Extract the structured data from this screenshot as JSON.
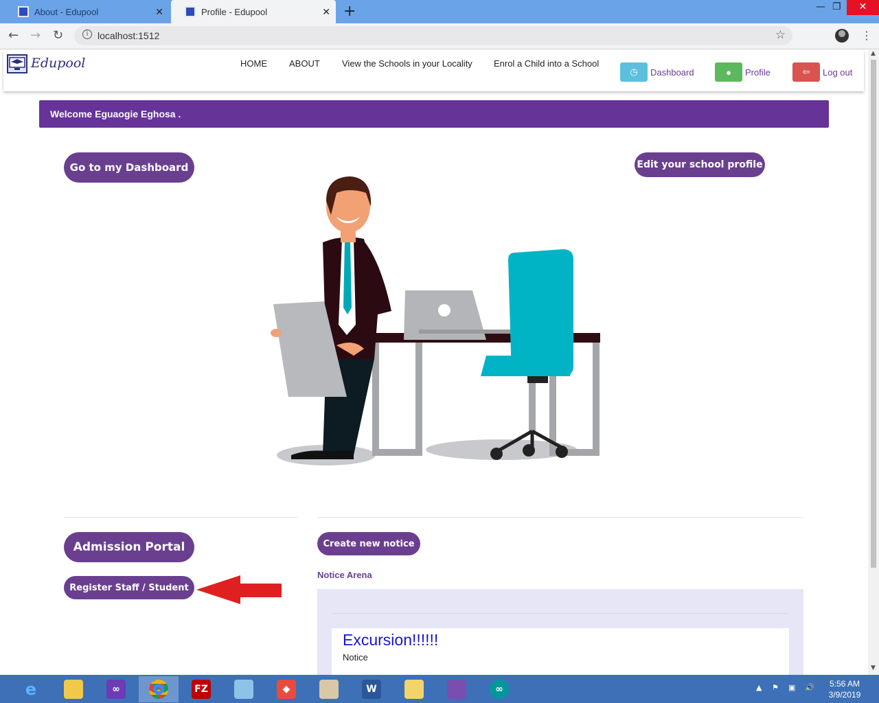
{
  "browser": {
    "tabs": [
      {
        "title": "About - Edupool"
      },
      {
        "title": "Profile - Edupool"
      }
    ],
    "url": "localhost:1512"
  },
  "navbar": {
    "brand": "Edupool",
    "links": [
      "HOME",
      "ABOUT",
      "View the Schools in your Locality",
      "Enrol a Child into a School"
    ],
    "buttons": [
      {
        "label": "Dashboard",
        "color": "#5bc0de"
      },
      {
        "label": "Profile",
        "color": "#5cb85c"
      },
      {
        "label": "Log out",
        "color": "#d9534f"
      }
    ]
  },
  "welcome": {
    "prefix": "Welcome ",
    "name": "Eguaogie Eghosa",
    "suffix": " ."
  },
  "actions": {
    "dashboard": "Go to my Dashboard",
    "edit_profile": "Edit your school profile",
    "admission_portal": "Admission Portal",
    "register": "Register Staff / Student",
    "create_notice": "Create new notice"
  },
  "notices": {
    "label": "Notice Arena",
    "items": [
      {
        "title": "Excursion!!!!!!",
        "body": "Notice"
      }
    ]
  },
  "taskbar": {
    "apps": [
      "internet-explorer",
      "file-explorer",
      "visual-studio",
      "chrome",
      "filezilla",
      "notepad",
      "git-app",
      "paint",
      "word",
      "outlook",
      "media-app",
      "arduino"
    ],
    "time": "5:56 AM",
    "date": "3/9/2019"
  },
  "colors": {
    "accent": "#663399",
    "pill": "#6a3f8f",
    "arrow": "#e02020"
  }
}
